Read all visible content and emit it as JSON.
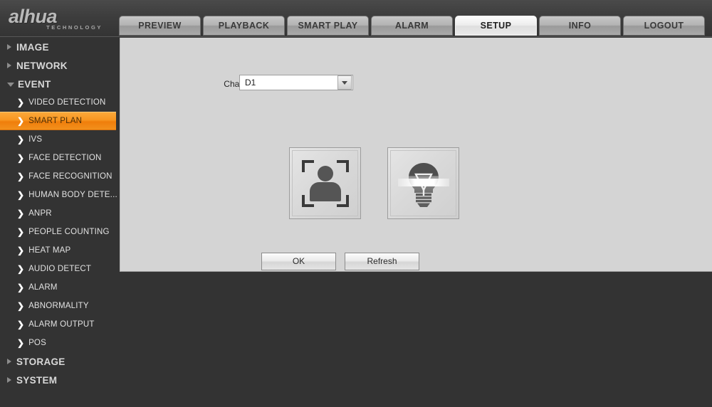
{
  "brand": {
    "name": "alhua",
    "tagline": "TECHNOLOGY"
  },
  "nav": {
    "tabs": [
      {
        "label": "PREVIEW",
        "active": false
      },
      {
        "label": "PLAYBACK",
        "active": false
      },
      {
        "label": "SMART PLAY",
        "active": false
      },
      {
        "label": "ALARM",
        "active": false
      },
      {
        "label": "SETUP",
        "active": true
      },
      {
        "label": "INFO",
        "active": false
      },
      {
        "label": "LOGOUT",
        "active": false
      }
    ]
  },
  "sidebar": {
    "items": [
      {
        "label": "IMAGE",
        "type": "group",
        "expanded": false
      },
      {
        "label": "NETWORK",
        "type": "group",
        "expanded": false
      },
      {
        "label": "EVENT",
        "type": "group",
        "expanded": true
      },
      {
        "label": "VIDEO DETECTION",
        "type": "item",
        "active": false
      },
      {
        "label": "SMART PLAN",
        "type": "item",
        "active": true
      },
      {
        "label": "IVS",
        "type": "item",
        "active": false
      },
      {
        "label": "FACE DETECTION",
        "type": "item",
        "active": false
      },
      {
        "label": "FACE RECOGNITION",
        "type": "item",
        "active": false
      },
      {
        "label": "HUMAN BODY DETE...",
        "type": "item",
        "active": false
      },
      {
        "label": "ANPR",
        "type": "item",
        "active": false
      },
      {
        "label": "PEOPLE COUNTING",
        "type": "item",
        "active": false
      },
      {
        "label": "HEAT MAP",
        "type": "item",
        "active": false
      },
      {
        "label": "AUDIO DETECT",
        "type": "item",
        "active": false
      },
      {
        "label": "ALARM",
        "type": "item",
        "active": false
      },
      {
        "label": "ABNORMALITY",
        "type": "item",
        "active": false
      },
      {
        "label": "ALARM OUTPUT",
        "type": "item",
        "active": false
      },
      {
        "label": "POS",
        "type": "item",
        "active": false
      },
      {
        "label": "STORAGE",
        "type": "group",
        "expanded": false
      },
      {
        "label": "SYSTEM",
        "type": "group",
        "expanded": false
      }
    ]
  },
  "panel": {
    "tab_label": "SMART PLAN",
    "channel": {
      "label": "Channel",
      "value": "D1",
      "options": [
        "D1"
      ]
    },
    "tiles": [
      {
        "icon": "face-detection-icon",
        "selected": false
      },
      {
        "icon": "light-bulb-icon",
        "selected": false
      }
    ],
    "buttons": {
      "ok_label": "OK",
      "refresh_label": "Refresh"
    }
  },
  "colors": {
    "accent": "#f79520",
    "header_bg": "#3d3d3d",
    "sidebar_bg": "#333333",
    "panel_bg": "#d4d4d4"
  }
}
